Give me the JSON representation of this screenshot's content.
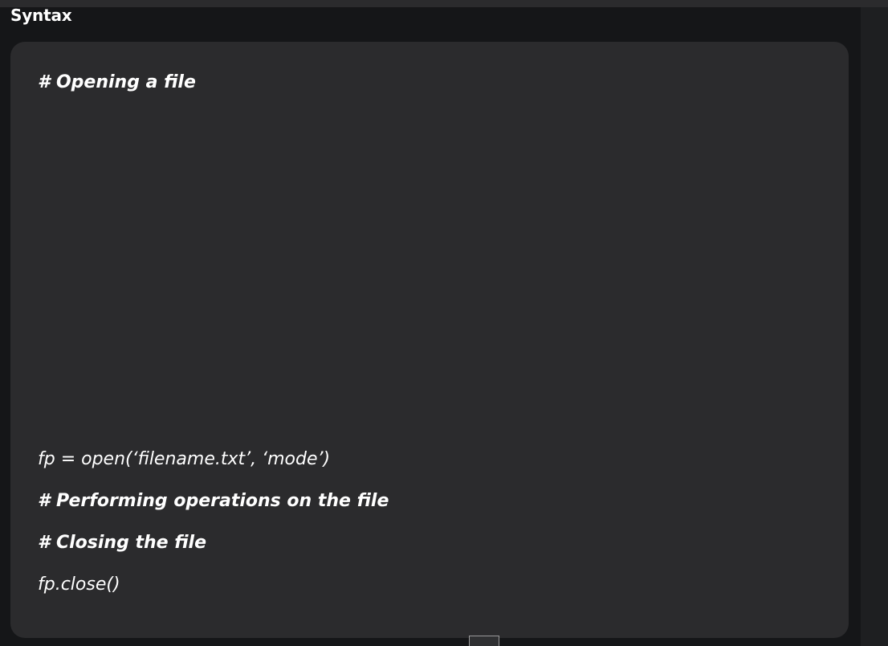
{
  "section": {
    "title": "Syntax"
  },
  "code_block": {
    "lines": [
      {
        "text": "# Opening a file",
        "kind": "comment"
      },
      {
        "text": "fp = open(‘filename.txt’, ‘mode’)",
        "kind": "code"
      },
      {
        "text": "# Performing operations on the file",
        "kind": "comment"
      },
      {
        "text": "# Closing the file",
        "kind": "comment"
      },
      {
        "text": "fp.close()",
        "kind": "code"
      }
    ]
  },
  "colors": {
    "page_background": "#151618",
    "card_background": "#2b2b2d",
    "text": "#ffffff",
    "right_rail": "#1e1f21"
  }
}
